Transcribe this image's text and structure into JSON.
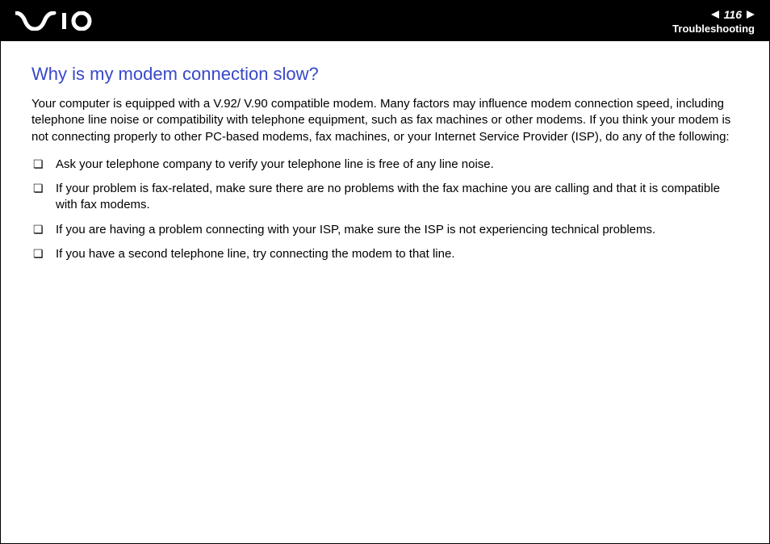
{
  "header": {
    "page_number": "116",
    "section": "Troubleshooting"
  },
  "content": {
    "heading": "Why is my modem connection slow?",
    "intro": "Your computer is equipped with a V.92/ V.90 compatible modem. Many factors may influence modem connection speed, including telephone line noise or compatibility with telephone equipment, such as fax machines or other modems. If you think your modem is not connecting properly to other PC-based modems, fax machines, or your Internet Service Provider (ISP), do any of the following:",
    "bullets": [
      "Ask your telephone company to verify your telephone line is free of any line noise.",
      "If your problem is fax-related, make sure there are no problems with the fax machine you are calling and that it is compatible with fax modems.",
      "If you are having a problem connecting with your ISP, make sure the ISP is not experiencing technical problems.",
      "If you have a second telephone line, try connecting the modem to that line."
    ]
  }
}
